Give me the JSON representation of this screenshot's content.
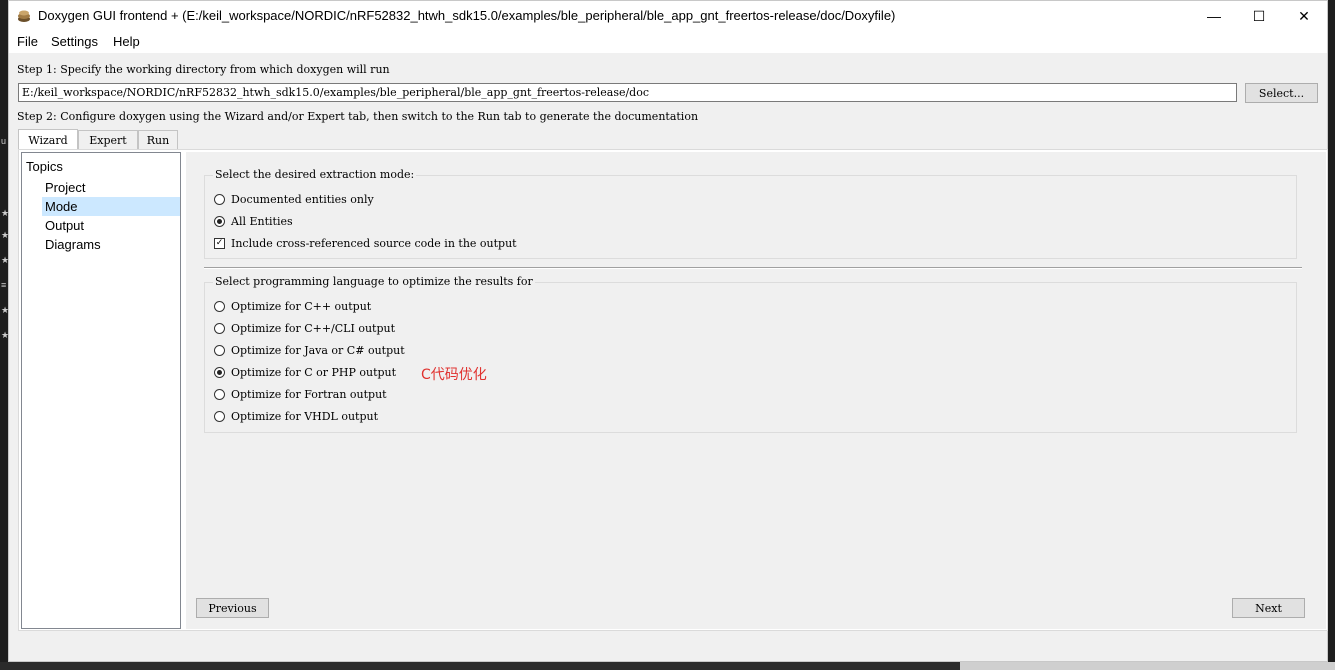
{
  "window": {
    "title": "Doxygen GUI frontend + (E:/keil_workspace/NORDIC/nRF52832_htwh_sdk15.0/examples/ble_peripheral/ble_app_gnt_freertos-release/doc/Doxyfile)",
    "minimize": "—",
    "maximize": "☐",
    "close": "✕"
  },
  "menu": [
    "File",
    "Settings",
    "Help"
  ],
  "step1": {
    "label": "Step 1: Specify the working directory from which doxygen will run",
    "directory": "E:/keil_workspace/NORDIC/nRF52832_htwh_sdk15.0/examples/ble_peripheral/ble_app_gnt_freertos-release/doc",
    "select_button": "Select..."
  },
  "step2": {
    "label": "Step 2: Configure doxygen using the Wizard and/or Expert tab, then switch to the Run tab to generate the documentation"
  },
  "tabs": [
    "Wizard",
    "Expert",
    "Run"
  ],
  "topics": {
    "heading": "Topics",
    "items": [
      "Project",
      "Mode",
      "Output",
      "Diagrams"
    ],
    "selected": "Mode"
  },
  "extraction": {
    "group_label": "Select the desired extraction mode:",
    "options": [
      "Documented entities only",
      "All Entities"
    ],
    "selected": "All Entities",
    "checkbox_label": "Include cross-referenced source code in the output",
    "checkbox_checked": true
  },
  "language": {
    "group_label": "Select programming language to optimize the results for",
    "options": [
      "Optimize for C++ output",
      "Optimize for C++/CLI output",
      "Optimize for Java or C# output",
      "Optimize for C or PHP output",
      "Optimize for Fortran output",
      "Optimize for VHDL output"
    ],
    "selected": "Optimize for C or PHP output"
  },
  "annotation": "C代码优化",
  "nav": {
    "previous": "Previous",
    "next": "Next"
  },
  "colors": {
    "annotation": "#e0312e",
    "selection": "#cce8ff"
  }
}
